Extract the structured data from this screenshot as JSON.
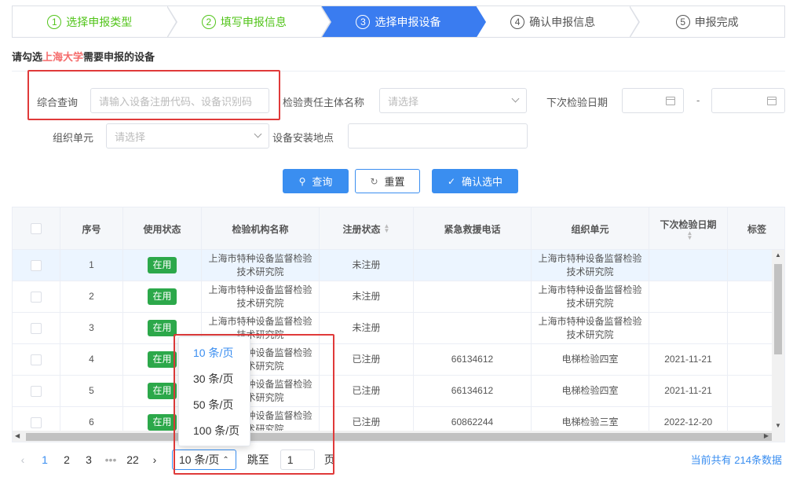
{
  "steps": [
    {
      "num": "1",
      "label": "选择申报类型"
    },
    {
      "num": "2",
      "label": "填写申报信息"
    },
    {
      "num": "3",
      "label": "选择申报设备"
    },
    {
      "num": "4",
      "label": "确认申报信息"
    },
    {
      "num": "5",
      "label": "申报完成"
    }
  ],
  "instruction": {
    "prefix": "请勾选",
    "highlight": "上海大学",
    "suffix": "需要申报的设备"
  },
  "filters": {
    "query_label": "综合查询",
    "query_placeholder": "请输入设备注册代码、设备识别码",
    "owner_label": "检验责任主体名称",
    "owner_placeholder": "请选择",
    "next_date_label": "下次检验日期",
    "date_sep": "-",
    "org_label": "组织单元",
    "org_placeholder": "请选择",
    "location_label": "设备安装地点"
  },
  "buttons": {
    "search": "查询",
    "reset": "重置",
    "confirm": "确认选中"
  },
  "table": {
    "headers": [
      "序号",
      "使用状态",
      "检验机构名称",
      "注册状态",
      "紧急救援电话",
      "组织单元",
      "下次检验日期",
      "标签"
    ],
    "rows": [
      {
        "no": "1",
        "status": "在用",
        "org": "上海市特种设备监督检验技术研究院",
        "reg": "未注册",
        "phone": "",
        "unit": "上海市特种设备监督检验技术研究院",
        "date": ""
      },
      {
        "no": "2",
        "status": "在用",
        "org": "上海市特种设备监督检验技术研究院",
        "reg": "未注册",
        "phone": "",
        "unit": "上海市特种设备监督检验技术研究院",
        "date": ""
      },
      {
        "no": "3",
        "status": "在用",
        "org": "上海市特种设备监督检验技术研究院",
        "reg": "未注册",
        "phone": "",
        "unit": "上海市特种设备监督检验技术研究院",
        "date": ""
      },
      {
        "no": "4",
        "status": "在用",
        "org": "上海市特种设备监督检验技术研究院",
        "reg": "已注册",
        "phone": "66134612",
        "unit": "电梯检验四室",
        "date": "2021-11-21"
      },
      {
        "no": "5",
        "status": "在用",
        "org": "上海市特种设备监督检验技术研究院",
        "reg": "已注册",
        "phone": "66134612",
        "unit": "电梯检验四室",
        "date": "2021-11-21"
      },
      {
        "no": "6",
        "status": "在用",
        "org": "上海市特种设备监督检验技术研究院",
        "reg": "已注册",
        "phone": "60862244",
        "unit": "电梯检验三室",
        "date": "2022-12-20"
      }
    ]
  },
  "page_size_options": [
    "10 条/页",
    "30 条/页",
    "50 条/页",
    "100 条/页"
  ],
  "pagination": {
    "pages": [
      "1",
      "2",
      "3",
      "•••",
      "22"
    ],
    "current_size": "10 条/页",
    "jump_label": "跳至",
    "jump_value": "1",
    "page_suffix": "页",
    "total_prefix": "当前共有 ",
    "total_count": "214",
    "total_suffix": "条数据"
  },
  "colors": {
    "primary": "#3a8ef0",
    "success": "#52c41a",
    "tag": "#2ca84a",
    "highlight": "#f56c6c",
    "annotation": "#e03a3a"
  }
}
